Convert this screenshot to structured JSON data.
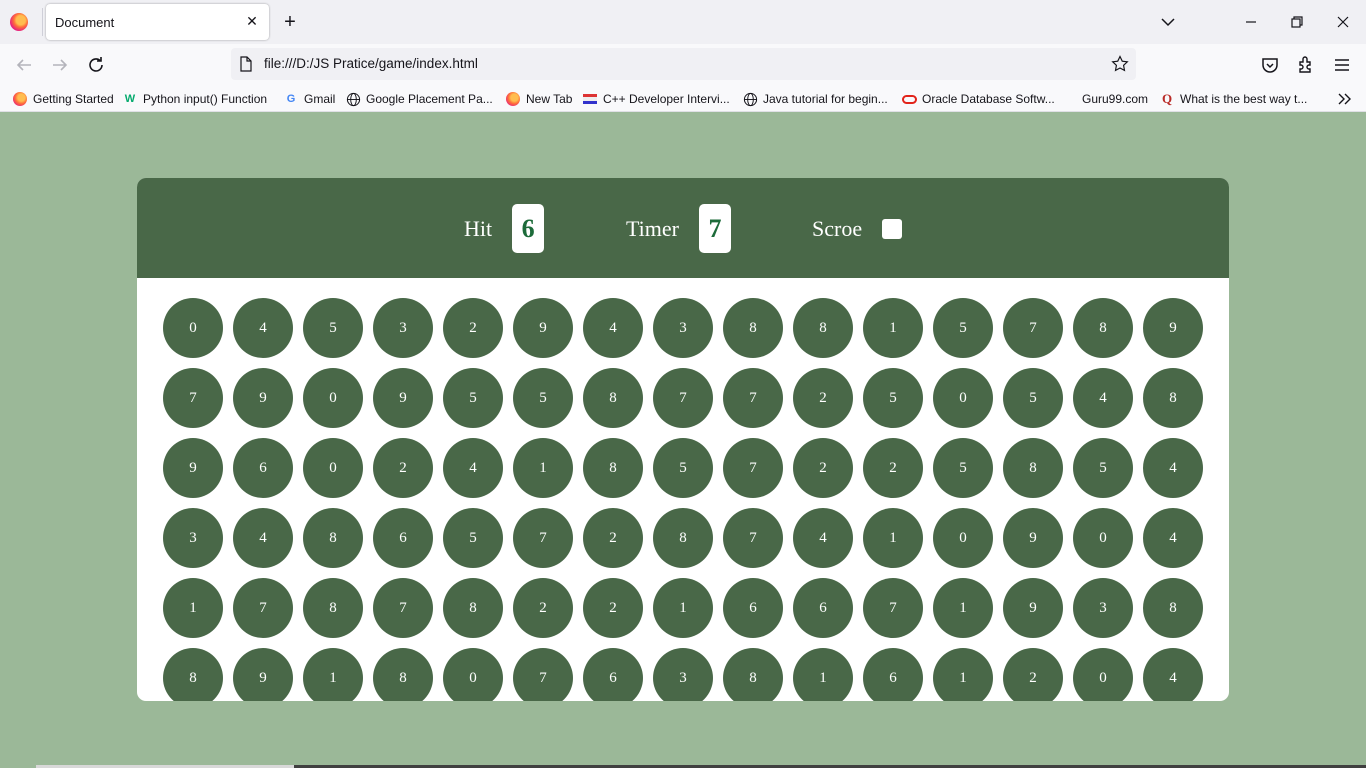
{
  "browser": {
    "tab_title": "Document",
    "tab_close": "✕",
    "new_tab": "+",
    "url": "file:///D:/JS Pratice/game/index.html",
    "bookmarks": [
      {
        "label": "Getting Started",
        "icon": "firefox-icon"
      },
      {
        "label": "Python input() Function",
        "icon": "w3schools-icon"
      },
      {
        "label": "Gmail",
        "icon": "google-icon"
      },
      {
        "label": "Google Placement Pa...",
        "icon": "globe-icon"
      },
      {
        "label": "New Tab",
        "icon": "firefox-icon"
      },
      {
        "label": "C++ Developer Intervi...",
        "icon": "site-icon"
      },
      {
        "label": "Java tutorial for begin...",
        "icon": "globe-icon"
      },
      {
        "label": "Oracle Database Softw...",
        "icon": "oracle-icon"
      },
      {
        "label": "Guru99.com",
        "icon": "none"
      },
      {
        "label": "What is the best way t...",
        "icon": "quora-icon"
      }
    ]
  },
  "game": {
    "hit_label": "Hit",
    "hit_value": "6",
    "timer_label": "Timer",
    "timer_value": "7",
    "score_label": "Scroe",
    "score_value": "",
    "bubbles": [
      [
        "0",
        "4",
        "5",
        "3",
        "2",
        "9",
        "4",
        "3",
        "8",
        "8",
        "1",
        "5",
        "7",
        "8",
        "9"
      ],
      [
        "7",
        "9",
        "0",
        "9",
        "5",
        "5",
        "8",
        "7",
        "7",
        "2",
        "5",
        "0",
        "5",
        "4",
        "8"
      ],
      [
        "9",
        "6",
        "0",
        "2",
        "4",
        "1",
        "8",
        "5",
        "7",
        "2",
        "2",
        "5",
        "8",
        "5",
        "4"
      ],
      [
        "3",
        "4",
        "8",
        "6",
        "5",
        "7",
        "2",
        "8",
        "7",
        "4",
        "1",
        "0",
        "9",
        "0",
        "4"
      ],
      [
        "1",
        "7",
        "8",
        "7",
        "8",
        "2",
        "2",
        "1",
        "6",
        "6",
        "7",
        "1",
        "9",
        "3",
        "8"
      ],
      [
        "8",
        "9",
        "1",
        "8",
        "0",
        "7",
        "6",
        "3",
        "8",
        "1",
        "6",
        "1",
        "2",
        "0",
        "4"
      ]
    ]
  },
  "colors": {
    "page_bg": "#9bb898",
    "panel_accent": "#496848",
    "stat_value": "#1d6b3a"
  }
}
